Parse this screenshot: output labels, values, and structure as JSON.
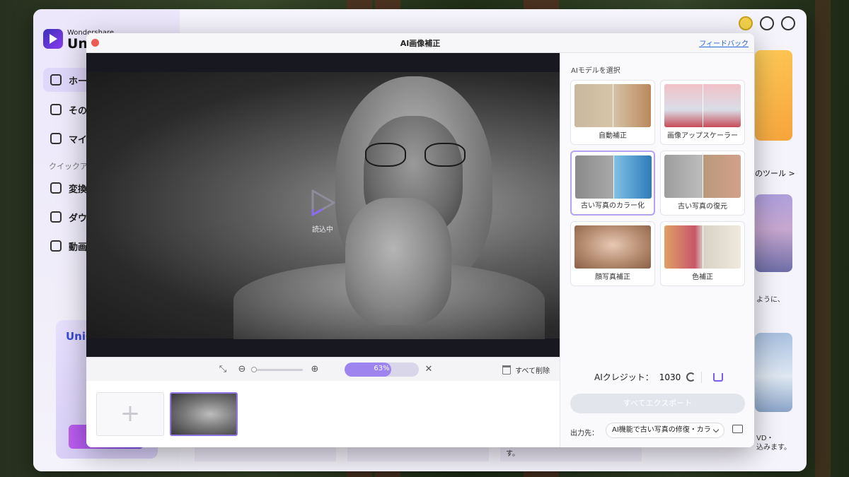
{
  "app": {
    "brand_top": "Wondershare",
    "brand_name": "UniC",
    "sidebar": {
      "items": [
        {
          "label": "ホー",
          "active": true
        },
        {
          "label": "その"
        },
        {
          "label": "マイ"
        }
      ],
      "quick_label": "クイックア",
      "quick_items": [
        {
          "label": "変換"
        },
        {
          "label": "ダウ"
        },
        {
          "label": "動画"
        }
      ],
      "promo_title": "UniC"
    },
    "background_texts": {
      "more_tools": "のツール >",
      "card1_text": "ように、",
      "card2_text_a": "VD・",
      "card2_text_b": "込みます。",
      "bottom_text": "す。"
    }
  },
  "dialog": {
    "title": "AI画像補正",
    "feedback": "フィードバック",
    "loading_text": "読込中",
    "zoom_progress_percent": 63,
    "progress_label": "63%",
    "delete_all": "すべて削除",
    "add_symbol": "+"
  },
  "panel": {
    "heading": "AIモデルを選択",
    "models": [
      {
        "label": "自動補正",
        "selected": false
      },
      {
        "label": "画像アップスケーラー",
        "selected": false
      },
      {
        "label": "古い写真のカラー化",
        "selected": true
      },
      {
        "label": "古い写真の復元",
        "selected": false
      },
      {
        "label": "顔写真補正",
        "selected": false
      },
      {
        "label": "色補正",
        "selected": false
      }
    ],
    "credits_label": "AIクレジット：",
    "credits_value": "1030",
    "export_label": "すべてエクスポート",
    "output_label": "出力先：",
    "output_value": "AI機能で古い写真の修復・カラ"
  },
  "colors": {
    "accent": "#8f74e8",
    "progress": "#9e84ee",
    "close": "#ee5b52",
    "link": "#2463d8"
  }
}
